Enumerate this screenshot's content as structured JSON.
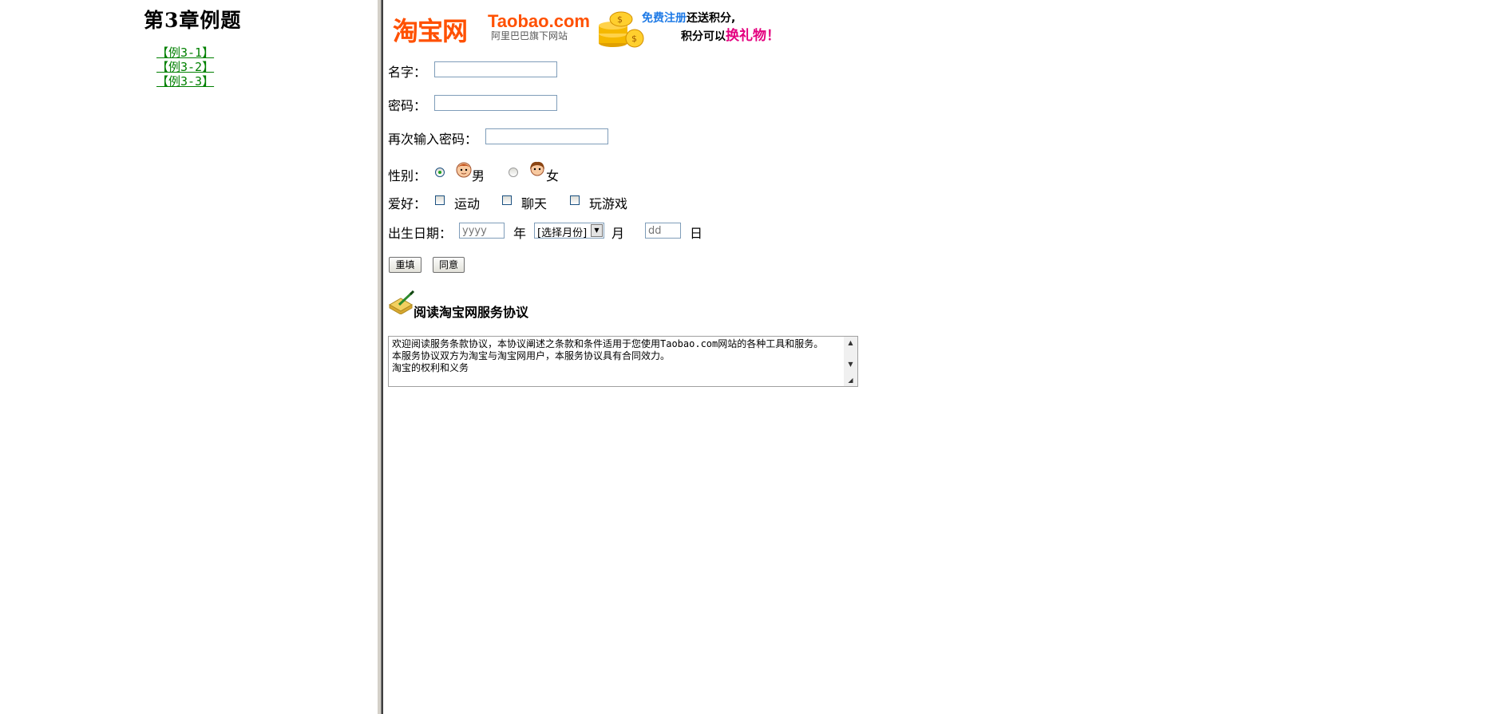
{
  "left": {
    "title": "第3章例题",
    "links": [
      "【例3-1】",
      "【例3-2】",
      "【例3-3】"
    ]
  },
  "banner": {
    "logo_cn": "淘宝网",
    "logo_en": "Taobao.com",
    "logo_sub": "阿里巴巴旗下网站",
    "promo_free_register": "免费注册",
    "promo_bonus": "还送积分,",
    "promo_points": "积分可以",
    "promo_gift": "换礼物！",
    "colors": {
      "orange": "#ff5000",
      "blue": "#1e7ae6",
      "pink": "#e4007f"
    }
  },
  "form": {
    "name_label": "名字：",
    "password_label": "密码：",
    "confirm_label": "再次输入密码：",
    "gender_label": "性别：",
    "gender_options": [
      "男",
      "女"
    ],
    "gender_selected": "男",
    "hobby_label": "爱好：",
    "hobby_options": [
      "运动",
      "聊天",
      "玩游戏"
    ],
    "birth_label": "出生日期：",
    "year_placeholder": "yyyy",
    "year_unit": "年",
    "month_select": "[选择月份]",
    "month_unit": "月",
    "day_placeholder": "dd",
    "day_unit": "日",
    "reset_label": "重填",
    "agree_label": "同意"
  },
  "agreement": {
    "heading": "阅读淘宝网服务协议",
    "text": "欢迎阅读服务条款协议，本协议阐述之条款和条件适用于您使用Taobao.com网站的各种工具和服务。\n本服务协议双方为淘宝与淘宝网用户，本服务协议具有合同效力。\n淘宝的权利和义务"
  }
}
